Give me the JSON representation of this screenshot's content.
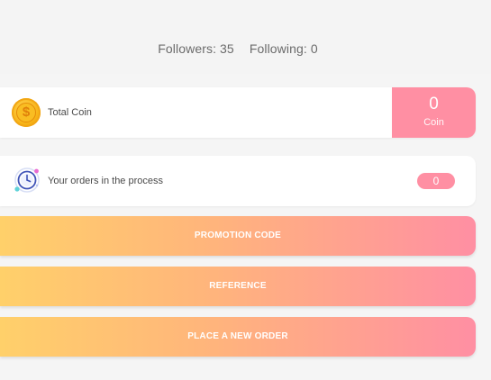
{
  "profile": {
    "followers_label": "Followers: 35",
    "following_label": "Following: 0"
  },
  "coin_card": {
    "label": "Total Coin",
    "value": "0",
    "unit": "Coin",
    "icon": "coin-icon",
    "icon_glyph": "$"
  },
  "orders_card": {
    "label": "Your orders in the process",
    "count": "0",
    "icon": "clock-icon"
  },
  "buttons": {
    "promotion": "PROMOTION CODE",
    "reference": "REFERENCE",
    "new_order": "PLACE A NEW ORDER"
  },
  "colors": {
    "accent_pink": "#ff8fa3",
    "gradient_start": "#ffd06a",
    "gradient_end": "#ff8fa3",
    "coin_gold": "#f7b418"
  }
}
